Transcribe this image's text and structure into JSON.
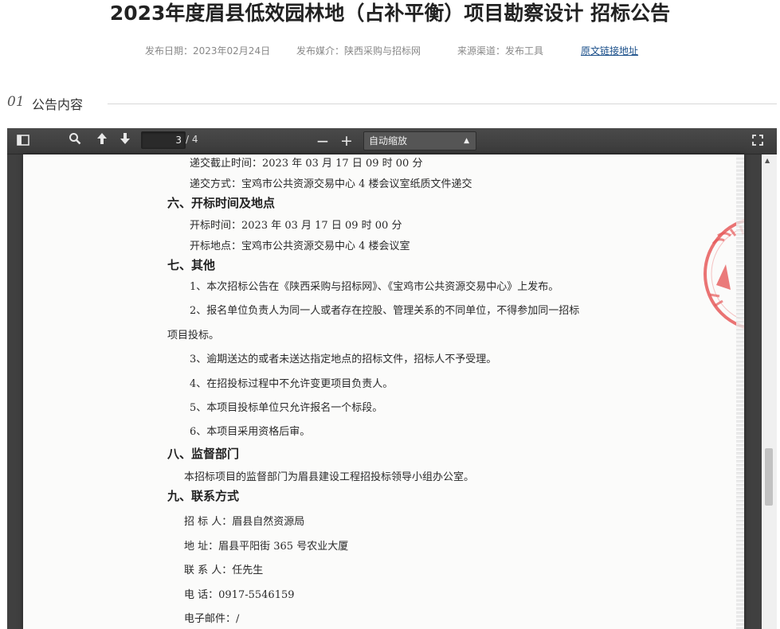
{
  "title": "2023年度眉县低效园林地（占补平衡）项目勘察设计 招标公告",
  "meta": {
    "date": "发布日期：2023年02月24日",
    "media": "发布媒介：陕西采购与招标网",
    "channel": "来源渠道：发布工具",
    "link": "原文链接地址"
  },
  "section": {
    "num": "01",
    "label": "公告内容"
  },
  "viewer": {
    "page_current": "3",
    "page_total": "/ 4",
    "zoom_label": "自动缩放",
    "zoom_out": "−",
    "zoom_in": "+"
  },
  "document": {
    "lines": [
      "递交截止时间：2023 年 03 月 17 日  09 时 00 分",
      "递交方式：宝鸡市公共资源交易中心 4 楼会议室纸质文件递交",
      "六、开标时间及地点",
      "开标时间：2023 年 03 月 17 日  09 时 00 分",
      "开标地点：宝鸡市公共资源交易中心 4 楼会议室",
      "七、其他",
      "1、本次招标公告在《陕西采购与招标网》、《宝鸡市公共资源交易中心》上发布。",
      "2、报名单位负责人为同一人或者存在控股、管理关系的不同单位，不得参加同一招标",
      "项目投标。",
      "3、逾期送达的或者未送达指定地点的招标文件，招标人不予受理。",
      "4、在招投标过程中不允许变更项目负责人。",
      "5、本项目投标单位只允许报名一个标段。",
      "6、本项目采用资格后审。",
      "八、监督部门",
      "本招标项目的监督部门为眉县建设工程招投标领导小组办公室。",
      "九、联系方式",
      "招  标  人：眉县自然资源局",
      "地        址：眉县平阳街 365 号农业大厦",
      "联  系  人：任先生",
      "电        话：0917-5546159",
      "电子邮件：/"
    ]
  }
}
